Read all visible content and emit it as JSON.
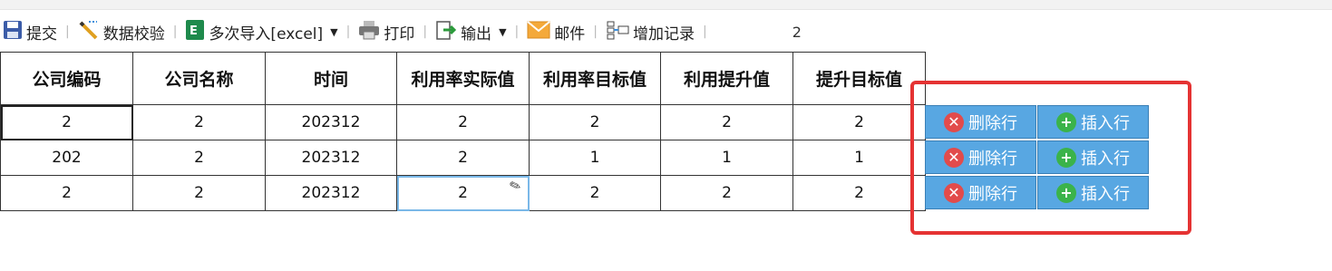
{
  "toolbar": {
    "submit": "提交",
    "validate": "数据校验",
    "import": "多次导入[excel]",
    "print": "打印",
    "export": "输出",
    "mail": "邮件",
    "add_record": "增加记录",
    "page_number": "2"
  },
  "table": {
    "headers": [
      "公司编码",
      "公司名称",
      "时间",
      "利用率实际值",
      "利用率目标值",
      "利用提升值",
      "提升目标值"
    ],
    "rows": [
      [
        "2",
        "2",
        "202312",
        "2",
        "2",
        "2",
        "2"
      ],
      [
        "202",
        "2",
        "202312",
        "2",
        "1",
        "1",
        "1"
      ],
      [
        "2",
        "2",
        "202312",
        "2",
        "2",
        "2",
        "2"
      ]
    ]
  },
  "row_actions": {
    "delete_label": "删除行",
    "insert_label": "插入行"
  },
  "colors": {
    "action_button": "#58a7e2",
    "highlight_border": "#e53333",
    "delete_icon": "#e24b4b",
    "insert_icon": "#3bb34a"
  },
  "icons": {
    "submit": "save-icon",
    "validate": "pencil-check-icon",
    "import": "excel-icon",
    "print": "printer-icon",
    "export": "export-icon",
    "mail": "envelope-icon",
    "add_record": "add-record-icon"
  }
}
